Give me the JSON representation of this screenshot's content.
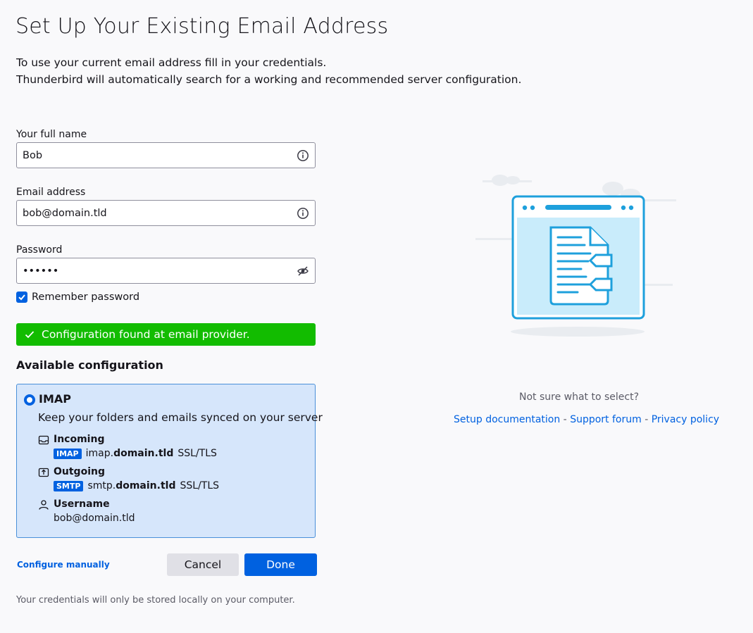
{
  "page": {
    "title": "Set Up Your Existing Email Address",
    "intro_line1": "To use your current email address fill in your credentials.",
    "intro_line2": "Thunderbird will automatically search for a working and recommended server configuration."
  },
  "form": {
    "name_label": "Your full name",
    "name_value": "Bob",
    "email_label": "Email address",
    "email_value": "bob@domain.tld",
    "password_label": "Password",
    "password_value": "••••••",
    "remember_label": "Remember password",
    "remember_checked": true
  },
  "status": {
    "message": "Configuration found at email provider.",
    "color": "#12bc00"
  },
  "config": {
    "section_title": "Available configuration",
    "protocol": "IMAP",
    "description": "Keep your folders and emails synced on your server",
    "incoming": {
      "title": "Incoming",
      "badge": "IMAP",
      "host_prefix": "imap.",
      "host_domain": "domain.tld",
      "security": "SSL/TLS"
    },
    "outgoing": {
      "title": "Outgoing",
      "badge": "SMTP",
      "host_prefix": "smtp.",
      "host_domain": "domain.tld",
      "security": "SSL/TLS"
    },
    "username": {
      "title": "Username",
      "value": "bob@domain.tld"
    }
  },
  "actions": {
    "configure_manually": "Configure manually",
    "cancel": "Cancel",
    "done": "Done"
  },
  "footnote": "Your credentials will only be stored locally on your computer.",
  "help": {
    "question": "Not sure what to select?",
    "setup_doc": "Setup documentation",
    "support": "Support forum",
    "privacy": "Privacy policy",
    "separator": " - "
  },
  "colors": {
    "accent": "#0061e0",
    "card_bg": "#d6e6fb",
    "illustration": "#1ea0dc"
  }
}
